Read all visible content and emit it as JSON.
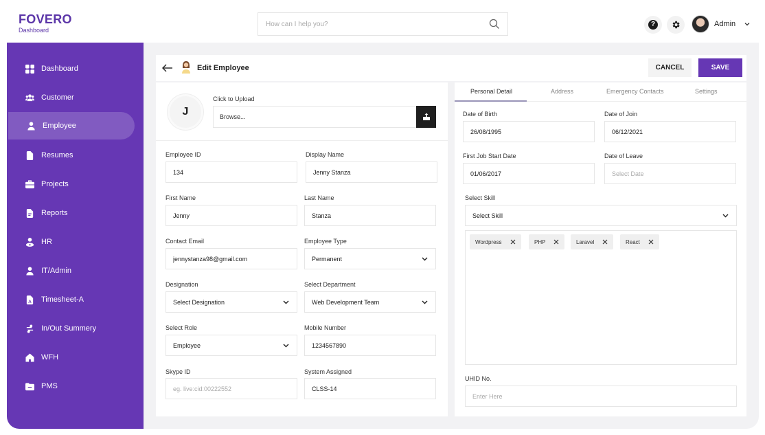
{
  "brand": {
    "name": "FOVERO",
    "subtitle": "Dashboard",
    "accent": "#6637b4"
  },
  "search": {
    "placeholder": "How can I help you?",
    "icon": "search-icon"
  },
  "header": {
    "help_icon": "help-icon",
    "settings_icon": "gear-icon",
    "help_glyph": "?",
    "user_name": "Admin"
  },
  "sidebar": {
    "items": [
      {
        "label": "Dashboard",
        "icon": "grid-icon",
        "active": false
      },
      {
        "label": "Customer",
        "icon": "users-icon",
        "active": false
      },
      {
        "label": "Employee",
        "icon": "user-icon",
        "active": true
      },
      {
        "label": "Resumes",
        "icon": "document-icon",
        "active": false
      },
      {
        "label": "Projects",
        "icon": "briefcase-icon",
        "active": false
      },
      {
        "label": "Reports",
        "icon": "report-icon",
        "active": false
      },
      {
        "label": "HR",
        "icon": "hr-icon",
        "active": false
      },
      {
        "label": "IT/Admin",
        "icon": "user-icon",
        "active": false
      },
      {
        "label": "Timesheet-A",
        "icon": "timesheet-icon",
        "active": false
      },
      {
        "label": "In/Out Summery",
        "icon": "swap-icon",
        "active": false
      },
      {
        "label": "WFH",
        "icon": "home-icon",
        "active": false
      },
      {
        "label": "PMS",
        "icon": "folder-icon",
        "active": false
      }
    ]
  },
  "page": {
    "title": "Edit Employee",
    "cancel_label": "CANCEL",
    "save_label": "SAVE"
  },
  "upload": {
    "avatar_initial": "J",
    "label": "Click to Upload",
    "browse_text": "Browse..."
  },
  "form_left": {
    "employee_id": {
      "label": "Employee ID",
      "value": "134"
    },
    "display_name": {
      "label": "Display Name",
      "value": "Jenny Stanza"
    },
    "first_name": {
      "label": "First Name",
      "value": "Jenny"
    },
    "last_name": {
      "label": "Last Name",
      "value": "Stanza"
    },
    "contact_email": {
      "label": "Contact Email",
      "value": "jennystanza98@gmail.com"
    },
    "employee_type": {
      "label": "Employee Type",
      "value": "Permanent"
    },
    "designation": {
      "label": "Designation",
      "value": "Select Designation"
    },
    "department": {
      "label": "Select Department",
      "value": "Web Development Team"
    },
    "role": {
      "label": "Select Role",
      "value": "Employee"
    },
    "mobile": {
      "label": "Mobile Number",
      "value": "1234567890"
    },
    "skype": {
      "label": "Skype ID",
      "placeholder": "eg. live:cid:00222552"
    },
    "system": {
      "label": "System Assigned",
      "value": "CLSS-14"
    }
  },
  "tabs": [
    {
      "label": "Personal Detail",
      "active": true
    },
    {
      "label": "Address",
      "active": false
    },
    {
      "label": "Emergency Contacts",
      "active": false
    },
    {
      "label": "Settings",
      "active": false
    }
  ],
  "form_right": {
    "dob": {
      "label": "Date of Birth",
      "value": "26/08/1995"
    },
    "doj": {
      "label": "Date of Join",
      "value": "06/12/2021"
    },
    "first_job": {
      "label": "First Job Start Date",
      "value": "01/06/2017"
    },
    "dol": {
      "label": "Date of Leave",
      "placeholder": "Select Date"
    },
    "skill": {
      "label": "Select Skill",
      "value": "Select Skill"
    },
    "skills": [
      "Wordpress",
      "PHP",
      "Laravel",
      "React"
    ],
    "uhid": {
      "label": "UHID No.",
      "placeholder": "Enter Here"
    }
  }
}
